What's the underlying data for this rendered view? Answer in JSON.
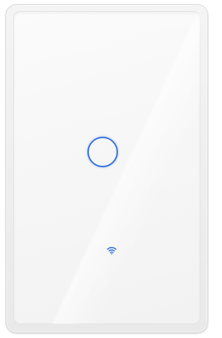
{
  "device": {
    "type": "smart touch wall switch",
    "frame_color": "#eeeeee",
    "panel_color": "#f7f7f7",
    "touch_button": {
      "indicator_color": "#2f6fe0",
      "icon": "circle-touch-ring"
    },
    "status_indicator": {
      "icon": "wifi-icon",
      "color": "#2f6fe0"
    }
  }
}
